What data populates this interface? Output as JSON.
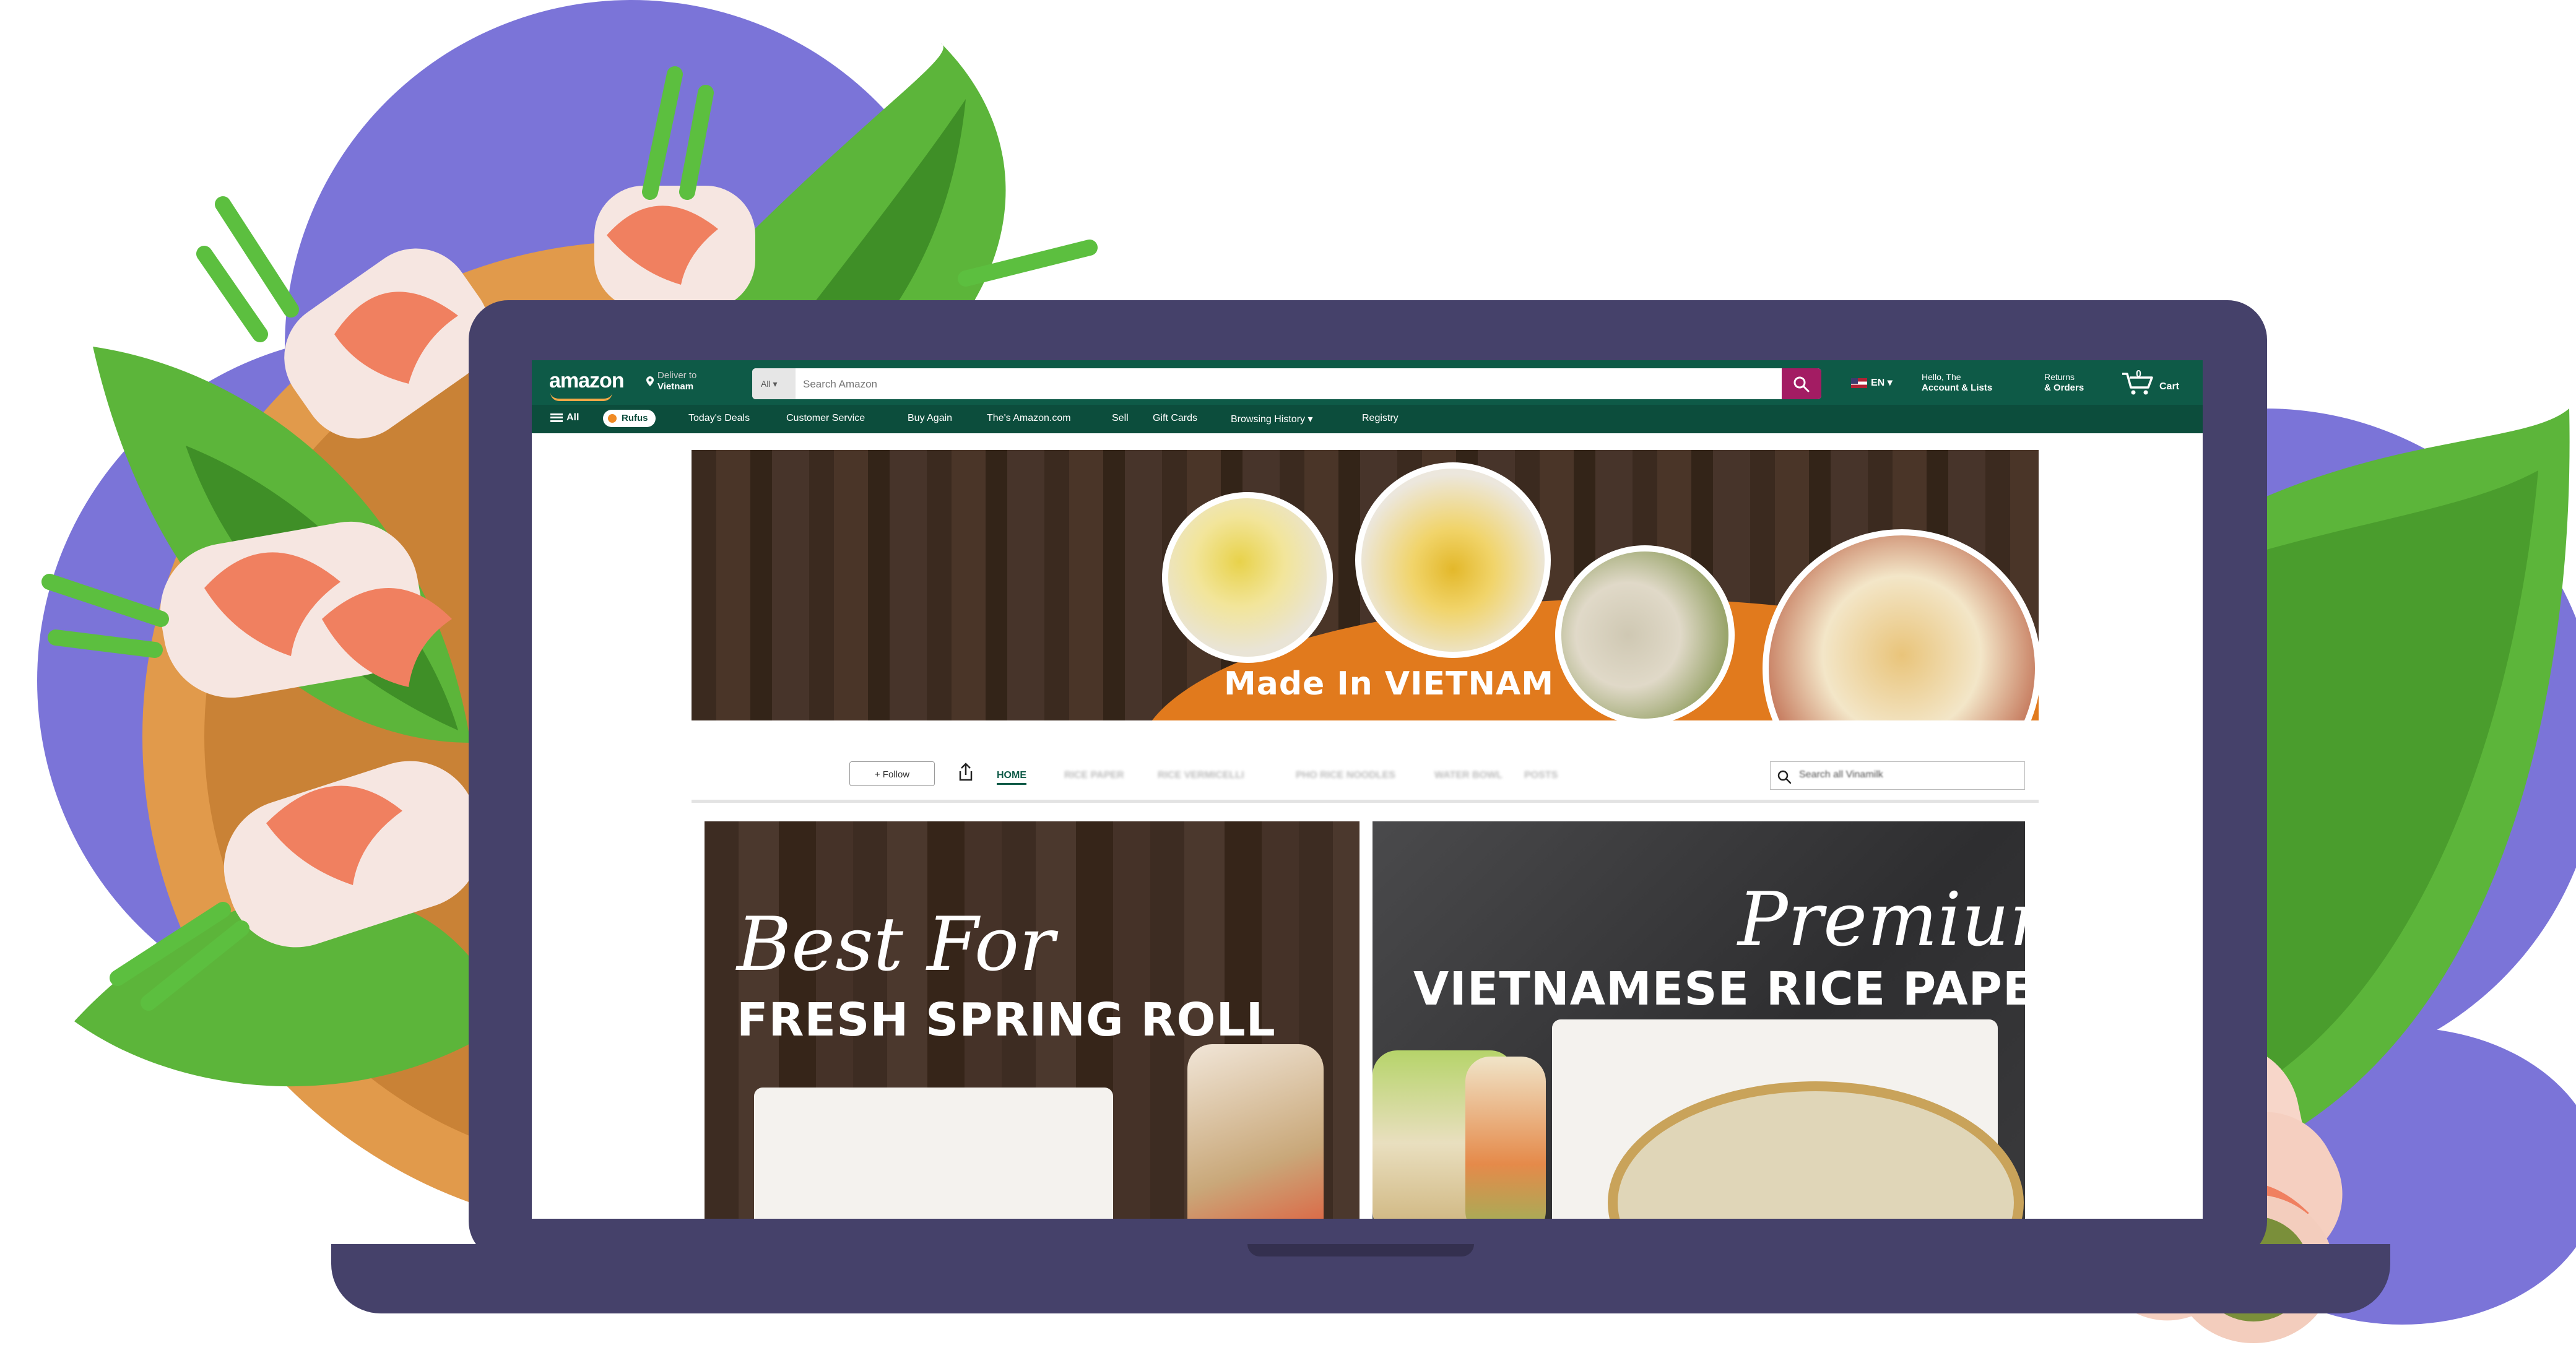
{
  "header": {
    "logo_text": "amazon",
    "deliver_line1": "Deliver to",
    "deliver_line2": "Vietnam",
    "search_category": "All",
    "search_placeholder": "Search Amazon",
    "language": "EN",
    "account_line1": "Hello, The",
    "account_line2": "Account & Lists",
    "returns_line1": "Returns",
    "returns_line2": "& Orders",
    "cart_count": "0",
    "cart_label": "Cart"
  },
  "subnav": {
    "all_label": "All",
    "rufus_label": "Rufus",
    "items": [
      "Today's Deals",
      "Customer Service",
      "Buy Again",
      "The's Amazon.com",
      "Sell",
      "Gift Cards",
      "Browsing History",
      "Registry"
    ]
  },
  "banner": {
    "tagline": "Made In VIETNAM"
  },
  "store_nav": {
    "follow_label": "+ Follow",
    "tabs": [
      "HOME",
      "RICE PAPER",
      "RICE VERMICELLI",
      "PHO RICE NOODLES",
      "WATER BOWL",
      "POSTS"
    ],
    "search_placeholder": "Search all Vinamilk"
  },
  "tiles": [
    {
      "script": "Best For",
      "headline": "FRESH SPRING ROLL"
    },
    {
      "script": "Premium",
      "headline": "VIETNAMESE RICE PAPER"
    }
  ],
  "colors": {
    "nav_green": "#0e5a47",
    "search_button": "#a31c63",
    "laptop_frame": "#45416a",
    "banner_orange": "#e17a1d",
    "halo_purple": "#7b74d8",
    "leaf_green": "#4caa2e"
  }
}
